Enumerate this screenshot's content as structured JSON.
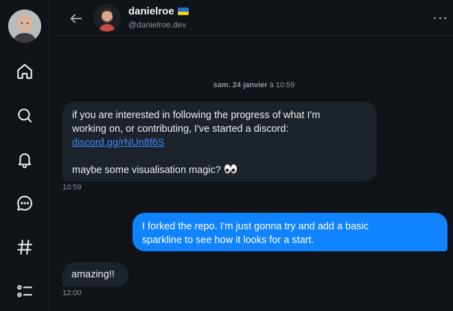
{
  "header": {
    "name": "danielroe",
    "handle": "@danielroe.dev"
  },
  "conversation": {
    "date_bold": "sam. 24 janvier",
    "date_rest": " à 10:59",
    "messages": [
      {
        "line1": "if you are interested in following the progress of what I'm",
        "line2": "working on, or contributing, I've started a discord:",
        "link": "discord.gg/rNUn8f6S",
        "line4": "maybe some visualisation magic? ",
        "time": "10:59"
      },
      {
        "line1": "I forked the repo. I'm just gonna try and add a basic",
        "line2": "sparkline to see how it looks for a start."
      },
      {
        "text": "amazing!!",
        "time": "12:00"
      }
    ]
  },
  "colors": {
    "background": "#101419",
    "incoming_bubble": "#1d232b",
    "outgoing_bubble": "#1083fe",
    "link": "#3c8bff"
  },
  "icons": [
    "home-icon",
    "search-icon",
    "bell-icon",
    "chat-icon",
    "hashtag-icon",
    "list-icon",
    "back-arrow-icon",
    "more-icon",
    "eyes-icon",
    "ukraine-flag-icon"
  ]
}
